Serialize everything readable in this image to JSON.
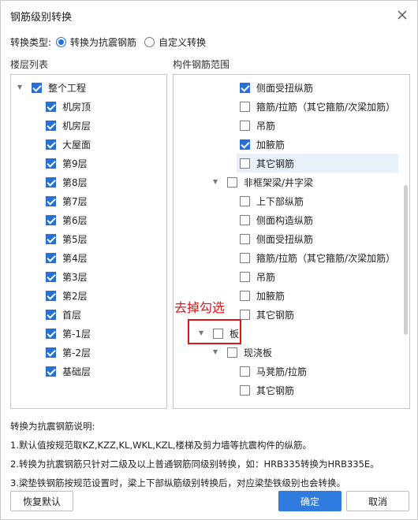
{
  "title": "钢筋级别转换",
  "conversion_type": {
    "label": "转换类型:",
    "options": [
      {
        "label": "转换为抗震钢筋",
        "selected": true
      },
      {
        "label": "自定义转换",
        "selected": false
      }
    ]
  },
  "floor_list": {
    "label": "楼层列表",
    "root": "整个工程",
    "floors": [
      "机房顶",
      "机房层",
      "大屋面",
      "第9层",
      "第8层",
      "第7层",
      "第6层",
      "第5层",
      "第4层",
      "第3层",
      "第2层",
      "首层",
      "第-1层",
      "第-2层",
      "基础层"
    ]
  },
  "component_range": {
    "label": "构件钢筋范围",
    "rows": [
      {
        "text": "侧面受扭纵筋",
        "checked": true
      },
      {
        "text": "箍筋/拉筋（其它箍筋/次梁加筋）",
        "checked": false
      },
      {
        "text": "吊筋",
        "checked": false
      },
      {
        "text": "加腋筋",
        "checked": true
      },
      {
        "text": "其它钢筋",
        "checked": false
      },
      {
        "text": "非框架梁/井字梁",
        "checked": false
      },
      {
        "text": "上下部纵筋",
        "checked": false
      },
      {
        "text": "侧面构造纵筋",
        "checked": false
      },
      {
        "text": "侧面受扭纵筋",
        "checked": false
      },
      {
        "text": "箍筋/拉筋（其它箍筋/次梁加筋）",
        "checked": false
      },
      {
        "text": "吊筋",
        "checked": false
      },
      {
        "text": "加腋筋",
        "checked": false
      },
      {
        "text": "其它钢筋",
        "checked": false
      },
      {
        "text": "板",
        "checked": false
      },
      {
        "text": "现浇板",
        "checked": false
      },
      {
        "text": "马凳筋/拉筋",
        "checked": false
      },
      {
        "text": "其它钢筋",
        "checked": false
      }
    ]
  },
  "annotation": "去掉勾选",
  "description": {
    "heading": "转换为抗震钢筋说明:",
    "lines": [
      "1.默认值按规范取KZ,KZZ,KL,WKL,KZL,楼梯及剪力墙等抗震构件的纵筋。",
      "2.转换为抗震钢筋只针对二级及以上普通钢筋同级别转换，如：HRB335转换为HRB335E。",
      "3.梁垫铁钢筋按规范设置时，梁上下部纵筋级别转换后，对应梁垫铁级别也会转换。"
    ]
  },
  "buttons": {
    "restore": "恢复默认",
    "ok": "确定",
    "cancel": "取消"
  },
  "colors": {
    "accent": "#2a6fd6",
    "annotation": "#e0151b"
  }
}
